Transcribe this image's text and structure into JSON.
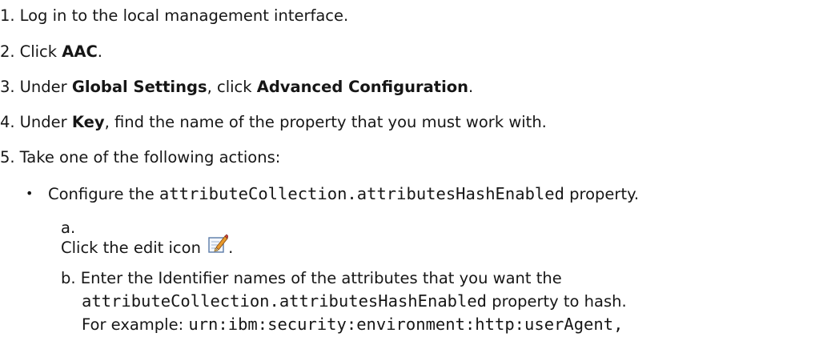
{
  "steps": [
    {
      "num": "1.",
      "text": "Log in to the local management interface."
    },
    {
      "num": "2.",
      "pre": "Click ",
      "bold": "AAC",
      "post": "."
    },
    {
      "num": "3.",
      "pre": "Under ",
      "bold": "Global Settings",
      "mid": ", click ",
      "bold2": "Advanced Configuration",
      "post": "."
    },
    {
      "num": "4.",
      "pre": "Under ",
      "bold": "Key",
      "post": ", find the name of the property that you must work with."
    },
    {
      "num": "5.",
      "text": "Take one of the following actions:"
    }
  ],
  "bullet": {
    "dot": "•",
    "pre": "Configure the ",
    "code": "attributeCollection.attributesHashEnabled",
    "post": " property."
  },
  "sub_a": {
    "letter": "a.",
    "text": "Click the edit icon ",
    "post": ".",
    "icon": "edit-icon"
  },
  "sub_b": {
    "letter": "b.",
    "line1": "Enter the Identifier names of the attributes that you want the",
    "line2_code": "attributeCollection.attributesHashEnabled",
    "line2_post": " property to hash.",
    "line3_pre": "For example: ",
    "line3_code": "urn:ibm:security:environment:http:userAgent,"
  }
}
